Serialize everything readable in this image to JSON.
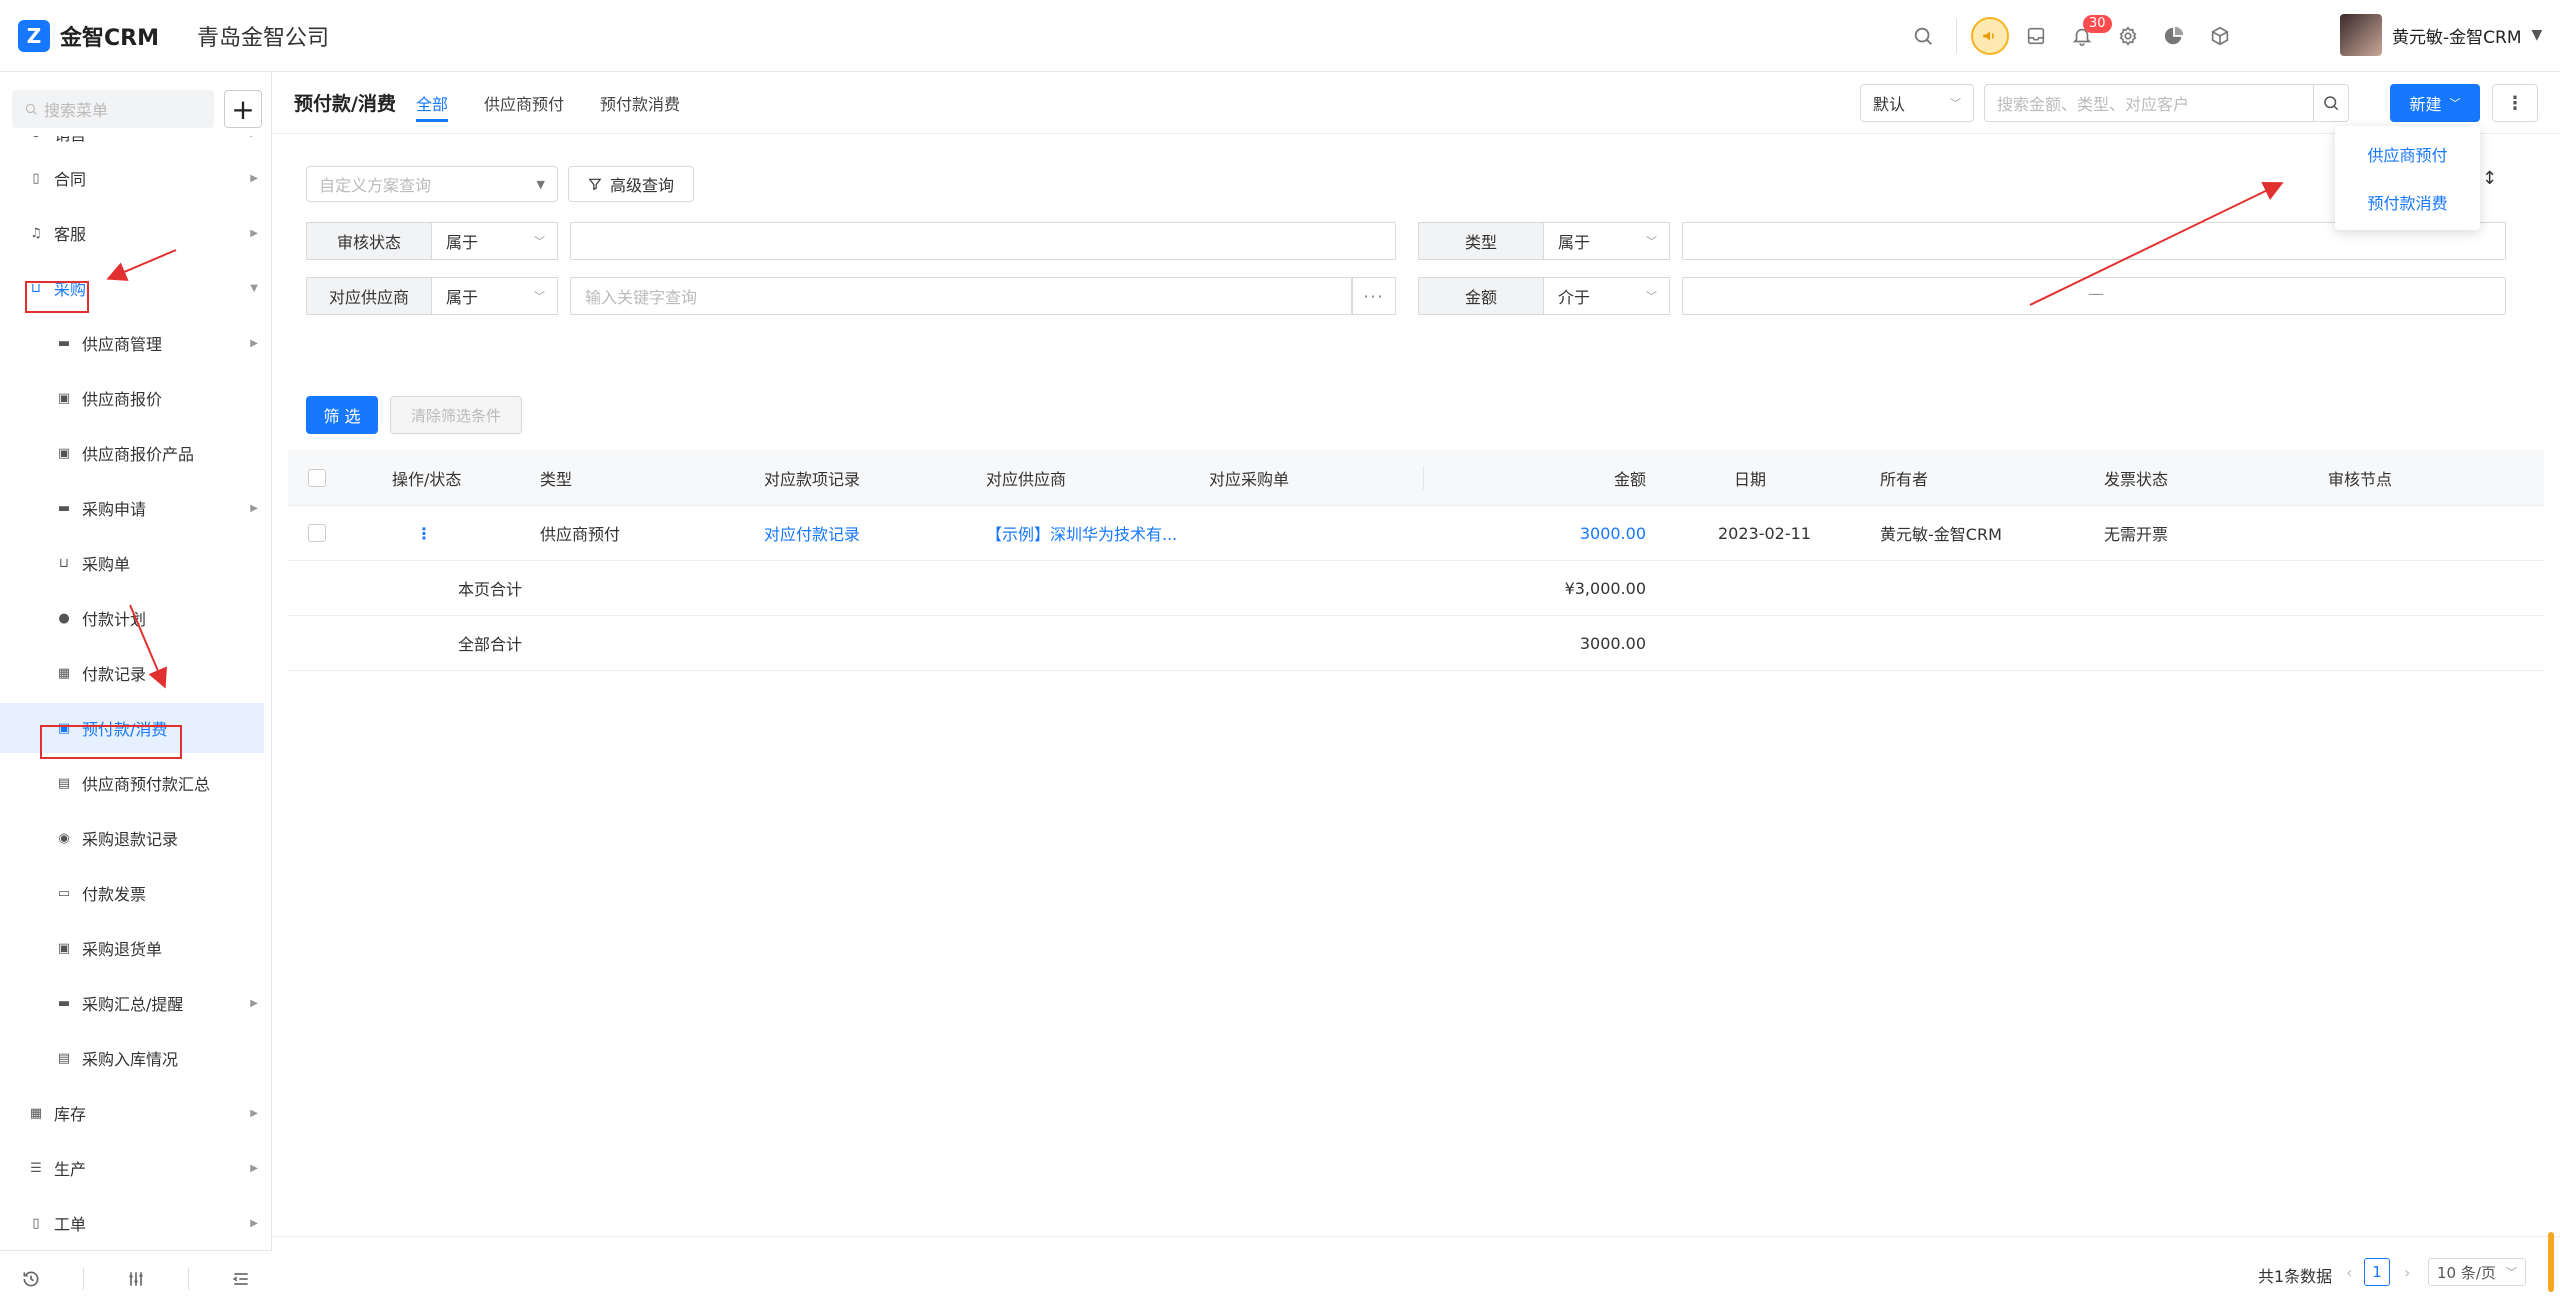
{
  "app": {
    "logo_text": "金智CRM",
    "company": "青岛金智公司",
    "logo_glyph": "Z"
  },
  "topbar": {
    "notification_count": "30",
    "user_name": "黄元敏-金智CRM"
  },
  "sidebar": {
    "search_placeholder": "搜索菜单",
    "add_label": "+",
    "items": [
      {
        "label": "销售",
        "level": 1
      },
      {
        "label": "合同",
        "level": 1
      },
      {
        "label": "客服",
        "level": 1
      },
      {
        "label": "采购",
        "level": 1
      },
      {
        "label": "供应商管理",
        "level": 2
      },
      {
        "label": "供应商报价",
        "level": 2
      },
      {
        "label": "供应商报价产品",
        "level": 2
      },
      {
        "label": "采购申请",
        "level": 2
      },
      {
        "label": "采购单",
        "level": 2
      },
      {
        "label": "付款计划",
        "level": 2
      },
      {
        "label": "付款记录",
        "level": 2
      },
      {
        "label": "预付款/消费",
        "level": 2
      },
      {
        "label": "供应商预付款汇总",
        "level": 2
      },
      {
        "label": "采购退款记录",
        "level": 2
      },
      {
        "label": "付款发票",
        "level": 2
      },
      {
        "label": "采购退货单",
        "level": 2
      },
      {
        "label": "采购汇总/提醒",
        "level": 2
      },
      {
        "label": "采购入库情况",
        "level": 2
      },
      {
        "label": "库存",
        "level": 1
      },
      {
        "label": "生产",
        "level": 1
      },
      {
        "label": "工单",
        "level": 1
      }
    ]
  },
  "header": {
    "page_title": "预付款/消费",
    "tabs": [
      {
        "label": "全部"
      },
      {
        "label": "供应商预付"
      },
      {
        "label": "预付款消费"
      }
    ],
    "view_select": "默认",
    "search_placeholder": "搜索金额、类型、对应客户",
    "new_label": "新建",
    "more_label": "⋮"
  },
  "new_dropdown": {
    "items": [
      {
        "label": "供应商预付"
      },
      {
        "label": "预付款消费"
      }
    ]
  },
  "filters": {
    "plan_placeholder": "自定义方案查询",
    "advanced_label": "高级查询",
    "rows": [
      {
        "label": "审核状态",
        "op": "属于",
        "value": ""
      },
      {
        "label": "类型",
        "op": "属于",
        "value": ""
      },
      {
        "label": "对应供应商",
        "op": "属于",
        "value": "输入关键字查询"
      },
      {
        "label": "金额",
        "op": "介于",
        "value": ""
      }
    ],
    "range_separator": "—",
    "more_dots": "···",
    "filter_label": "筛 选",
    "clear_label": "清除筛选条件"
  },
  "table": {
    "columns": [
      "操作/状态",
      "类型",
      "对应款项记录",
      "对应供应商",
      "对应采购单",
      "金额",
      "日期",
      "所有者",
      "发票状态",
      "审核节点"
    ],
    "rows": [
      {
        "action": "⋮",
        "type": "供应商预付",
        "record": "对应付款记录",
        "supplier": "【示例】深圳华为技术有...",
        "order": "",
        "amount": "3000.00",
        "date": "2023-02-11",
        "owner": "黄元敏-金智CRM",
        "invoice": "无需开票",
        "audit": ""
      }
    ],
    "page_total_label": "本页合计",
    "page_total_value": "¥3,000.00",
    "all_total_label": "全部合计",
    "all_total_value": "3000.00"
  },
  "pagination": {
    "total_text": "共1条数据",
    "current_page": "1",
    "page_size": "10 条/页"
  },
  "colors": {
    "accent": "#1677ff",
    "annotation": "#e23030"
  }
}
